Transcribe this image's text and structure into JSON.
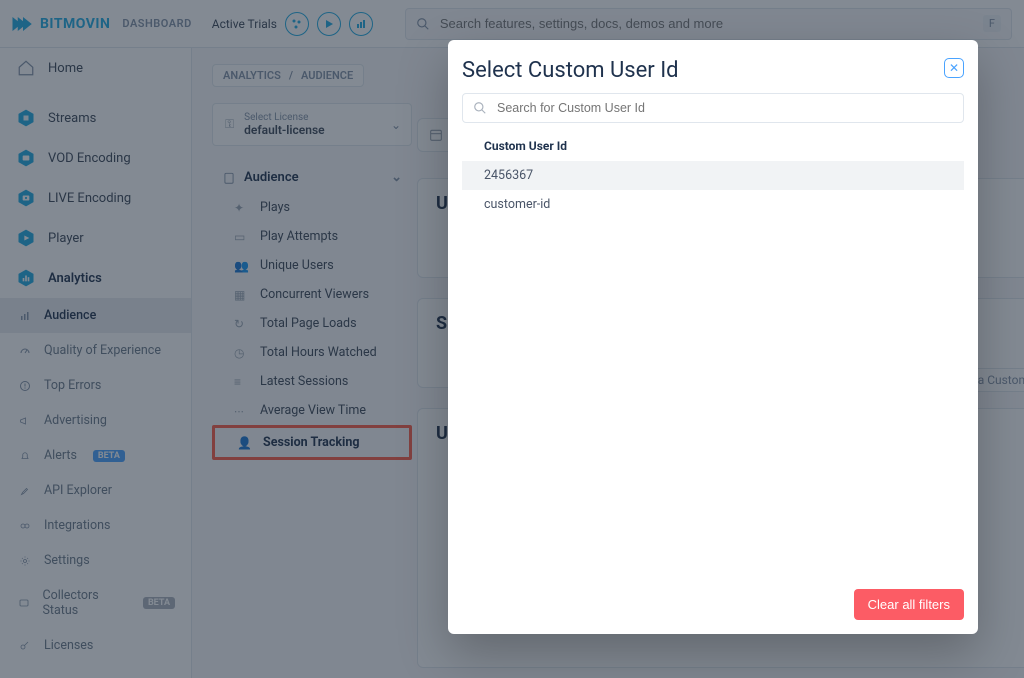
{
  "brand": "BITMOVIN",
  "dashboard_label": "DASHBOARD",
  "active_trials_label": "Active Trials",
  "search": {
    "placeholder": "Search features, settings, docs, demos and more",
    "shortcut": "F"
  },
  "nav": {
    "home": "Home",
    "streams": "Streams",
    "vod": "VOD Encoding",
    "live": "LIVE Encoding",
    "player": "Player",
    "analytics": "Analytics",
    "sub_audience": "Audience",
    "sub_qoe": "Quality of Experience",
    "sub_top_errors": "Top Errors",
    "sub_advertising": "Advertising",
    "sub_alerts": "Alerts",
    "sub_alerts_badge": "BETA",
    "sub_api": "API Explorer",
    "sub_integrations": "Integrations",
    "sub_settings": "Settings",
    "sub_collectors": "Collectors Status",
    "sub_collectors_badge": "BETA",
    "sub_licenses": "Licenses"
  },
  "breadcrumb": {
    "a": "ANALYTICS",
    "sep": "/",
    "b": "AUDIENCE"
  },
  "license": {
    "label": "Select License",
    "value": "default-license"
  },
  "subnav": {
    "head": "Audience",
    "items": [
      "Plays",
      "Play Attempts",
      "Unique Users",
      "Concurrent Viewers",
      "Total Page Loads",
      "Total Hours Watched",
      "Latest Sessions",
      "Average View Time",
      "Session Tracking"
    ]
  },
  "cards": {
    "c2_initial": "U",
    "c3_initial": "S",
    "c4_initial": "U"
  },
  "filter_tag": "a Custom",
  "modal": {
    "title": "Select Custom User Id",
    "search_placeholder": "Search for Custom User Id",
    "column_header": "Custom User Id",
    "options": [
      "2456367",
      "customer-id"
    ],
    "clear_button": "Clear all filters"
  }
}
